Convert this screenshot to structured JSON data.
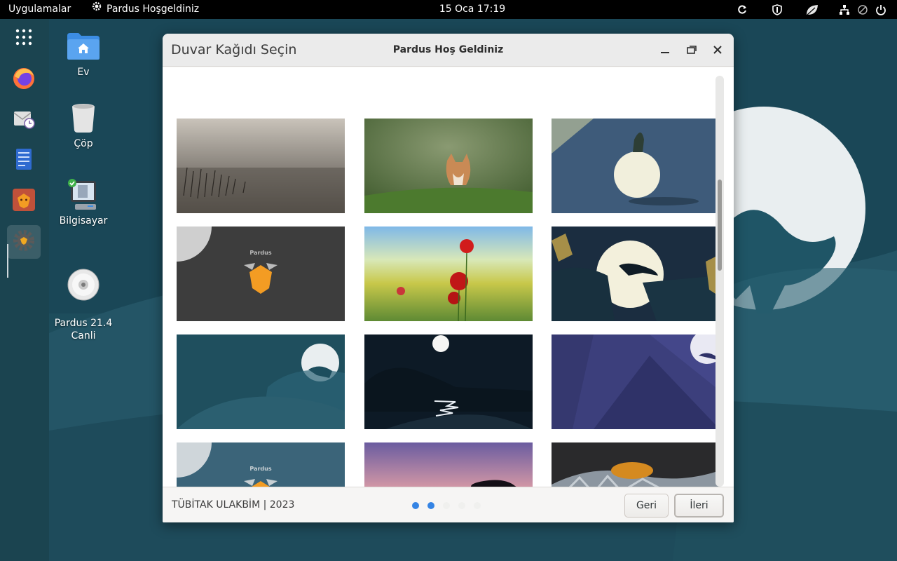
{
  "topbar": {
    "activities": "Uygulamalar",
    "app_name": "Pardus Hoşgeldiniz",
    "clock": "15 Oca  17:19"
  },
  "desktop": {
    "icons": [
      {
        "label": "Ev",
        "icon": "home-folder-icon"
      },
      {
        "label": "Çöp",
        "icon": "trash-icon"
      },
      {
        "label": "Bilgisayar",
        "icon": "computer-icon"
      },
      {
        "label": "Pardus 21.4\nCanli",
        "icon": "cd-icon"
      }
    ]
  },
  "dock": {
    "items": [
      "app-grid-icon",
      "firefox-icon",
      "mail-icon",
      "text-editor-icon",
      "pardus-store-icon",
      "settings-icon"
    ]
  },
  "window": {
    "subtitle": "Duvar Kağıdı Seçin",
    "title": "Pardus Hoş Geldiniz",
    "footer_text": "TÜBİTAK ULAKBİM | 2023",
    "back_label": "Geri",
    "next_label": "İleri",
    "pages_total": 5,
    "current_page": 2
  },
  "colors": {
    "accent": "#3584e4",
    "desktop_bg": "#1b4a5a"
  }
}
